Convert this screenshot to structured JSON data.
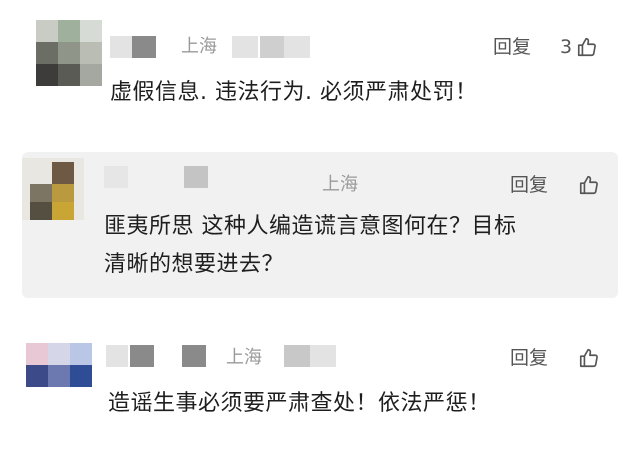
{
  "comments": [
    {
      "location": "上海",
      "reply_label": "回复",
      "like_count": "3",
      "text": "虚假信息. 违法行为. 必须严肃处罚！"
    },
    {
      "location": "上海",
      "reply_label": "回复",
      "like_count": "",
      "text_line1": "匪夷所思  这种人编造谎言意图何在？目标",
      "text_line2": "清晰的想要进去？"
    },
    {
      "location": "上海",
      "reply_label": "回复",
      "like_count": "",
      "text": "造谣生事必须要严肃查处！依法严惩！"
    }
  ],
  "icons": {
    "like": "thumbs-up-icon"
  },
  "colors": {
    "reply_background": "#f1f1f1",
    "meta_text": "#9a9a9a"
  }
}
